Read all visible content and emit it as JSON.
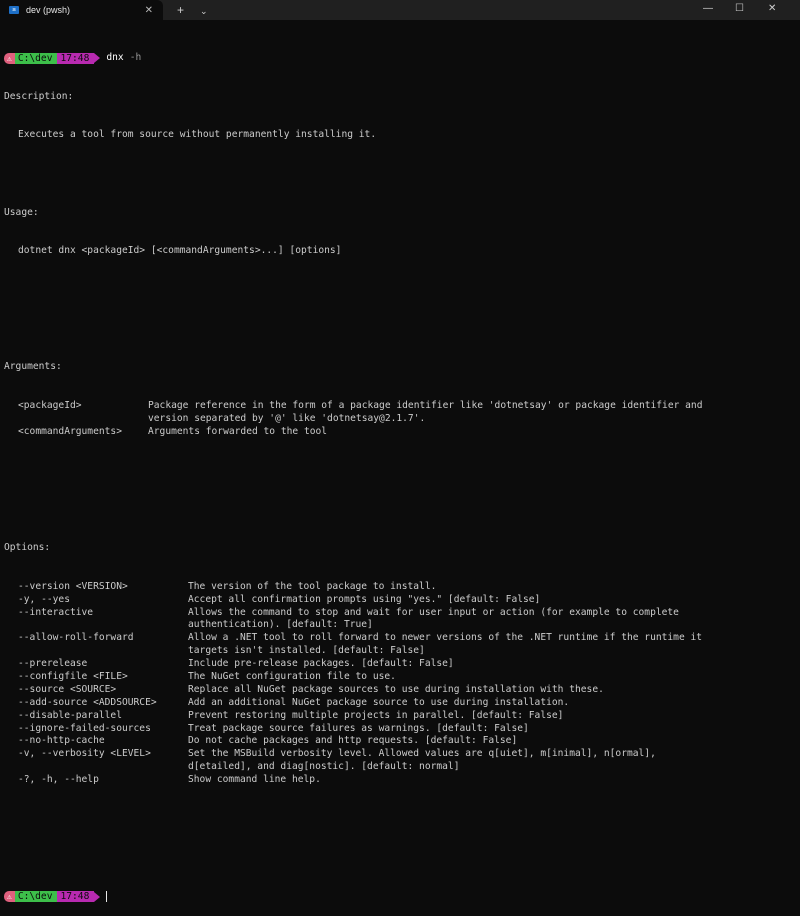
{
  "window": {
    "tab_title": "dev (pwsh)",
    "tab_icon_glyph": "≥",
    "tab_close": "✕",
    "new_tab": "+",
    "dropdown": "⌄",
    "minimize": "—",
    "maximize": "☐",
    "close": "✕"
  },
  "prompt": {
    "user_glyph": "⚠",
    "path": "C:\\dev",
    "time": "17:48",
    "command": "dnx",
    "flag": "-h"
  },
  "help": {
    "description_header": "Description:",
    "description": "Executes a tool from source without permanently installing it.",
    "usage_header": "Usage:",
    "usage": "dotnet dnx <packageId> [<commandArguments>...] [options]",
    "arguments_header": "Arguments:",
    "arguments": [
      {
        "name": "<packageId>",
        "desc": "Package reference in the form of a package identifier like 'dotnetsay' or package identifier and",
        "cont": "version separated by '@' like 'dotnetsay@2.1.7'."
      },
      {
        "name": "<commandArguments>",
        "desc": "Arguments forwarded to the tool",
        "cont": ""
      }
    ],
    "options_header": "Options:",
    "options": [
      {
        "name": "--version <VERSION>",
        "desc": "The version of the tool package to install.",
        "cont": ""
      },
      {
        "name": "-y, --yes",
        "desc": "Accept all confirmation prompts using \"yes.\" [default: False]",
        "cont": ""
      },
      {
        "name": "--interactive",
        "desc": "Allows the command to stop and wait for user input or action (for example to complete",
        "cont": "authentication). [default: True]"
      },
      {
        "name": "--allow-roll-forward",
        "desc": "Allow a .NET tool to roll forward to newer versions of the .NET runtime if the runtime it",
        "cont": "targets isn't installed. [default: False]"
      },
      {
        "name": "--prerelease",
        "desc": "Include pre-release packages. [default: False]",
        "cont": ""
      },
      {
        "name": "--configfile <FILE>",
        "desc": "The NuGet configuration file to use.",
        "cont": ""
      },
      {
        "name": "--source <SOURCE>",
        "desc": "Replace all NuGet package sources to use during installation with these.",
        "cont": ""
      },
      {
        "name": "--add-source <ADDSOURCE>",
        "desc": "Add an additional NuGet package source to use during installation.",
        "cont": ""
      },
      {
        "name": "--disable-parallel",
        "desc": "Prevent restoring multiple projects in parallel. [default: False]",
        "cont": ""
      },
      {
        "name": "--ignore-failed-sources",
        "desc": "Treat package source failures as warnings. [default: False]",
        "cont": ""
      },
      {
        "name": "--no-http-cache",
        "desc": "Do not cache packages and http requests. [default: False]",
        "cont": ""
      },
      {
        "name": "-v, --verbosity <LEVEL>",
        "desc": "Set the MSBuild verbosity level. Allowed values are q[uiet], m[inimal], n[ormal],",
        "cont": "d[etailed], and diag[nostic]. [default: normal]"
      },
      {
        "name": "-?, -h, --help",
        "desc": "Show command line help.",
        "cont": ""
      }
    ]
  }
}
